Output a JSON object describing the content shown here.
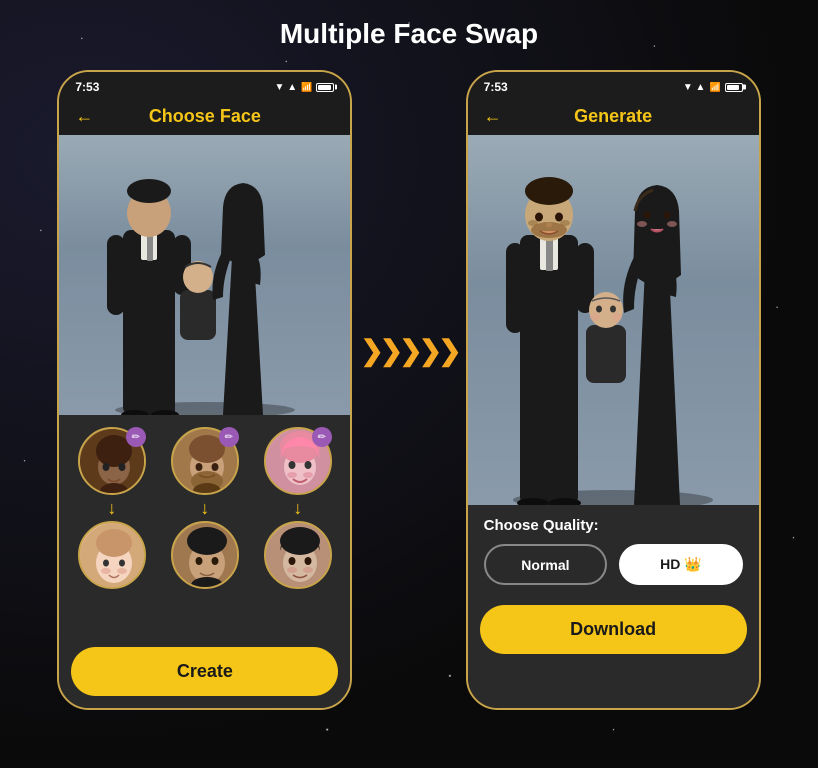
{
  "page": {
    "title": "Multiple Face Swap",
    "background_color": "#0a0a0a"
  },
  "left_phone": {
    "status_time": "7:53",
    "header_title": "Choose Face",
    "back_arrow": "←",
    "create_button": "Create",
    "face_sources": [
      {
        "id": "face1",
        "type": "dark-man",
        "emoji": "🧑"
      },
      {
        "id": "face2",
        "type": "bearded-man",
        "emoji": "🧔"
      },
      {
        "id": "face3",
        "type": "woman",
        "emoji": "👩"
      }
    ],
    "face_targets": [
      {
        "id": "target1",
        "type": "baby",
        "emoji": "👶"
      },
      {
        "id": "target2",
        "type": "asian-man",
        "emoji": "🧑"
      },
      {
        "id": "target3",
        "type": "woman2",
        "emoji": "👩"
      }
    ],
    "edit_icon": "✏️"
  },
  "right_phone": {
    "status_time": "7:53",
    "header_title": "Generate",
    "back_arrow": "←",
    "quality_label": "Choose Quality:",
    "quality_normal": "Normal",
    "quality_hd": "HD 👑",
    "download_button": "Download"
  },
  "arrows_between": "❯❯❯❯❯",
  "icons": {
    "back": "←",
    "edit": "✏",
    "arrow_down": "↓",
    "signal": "▲▲▲",
    "wifi": "▲"
  }
}
